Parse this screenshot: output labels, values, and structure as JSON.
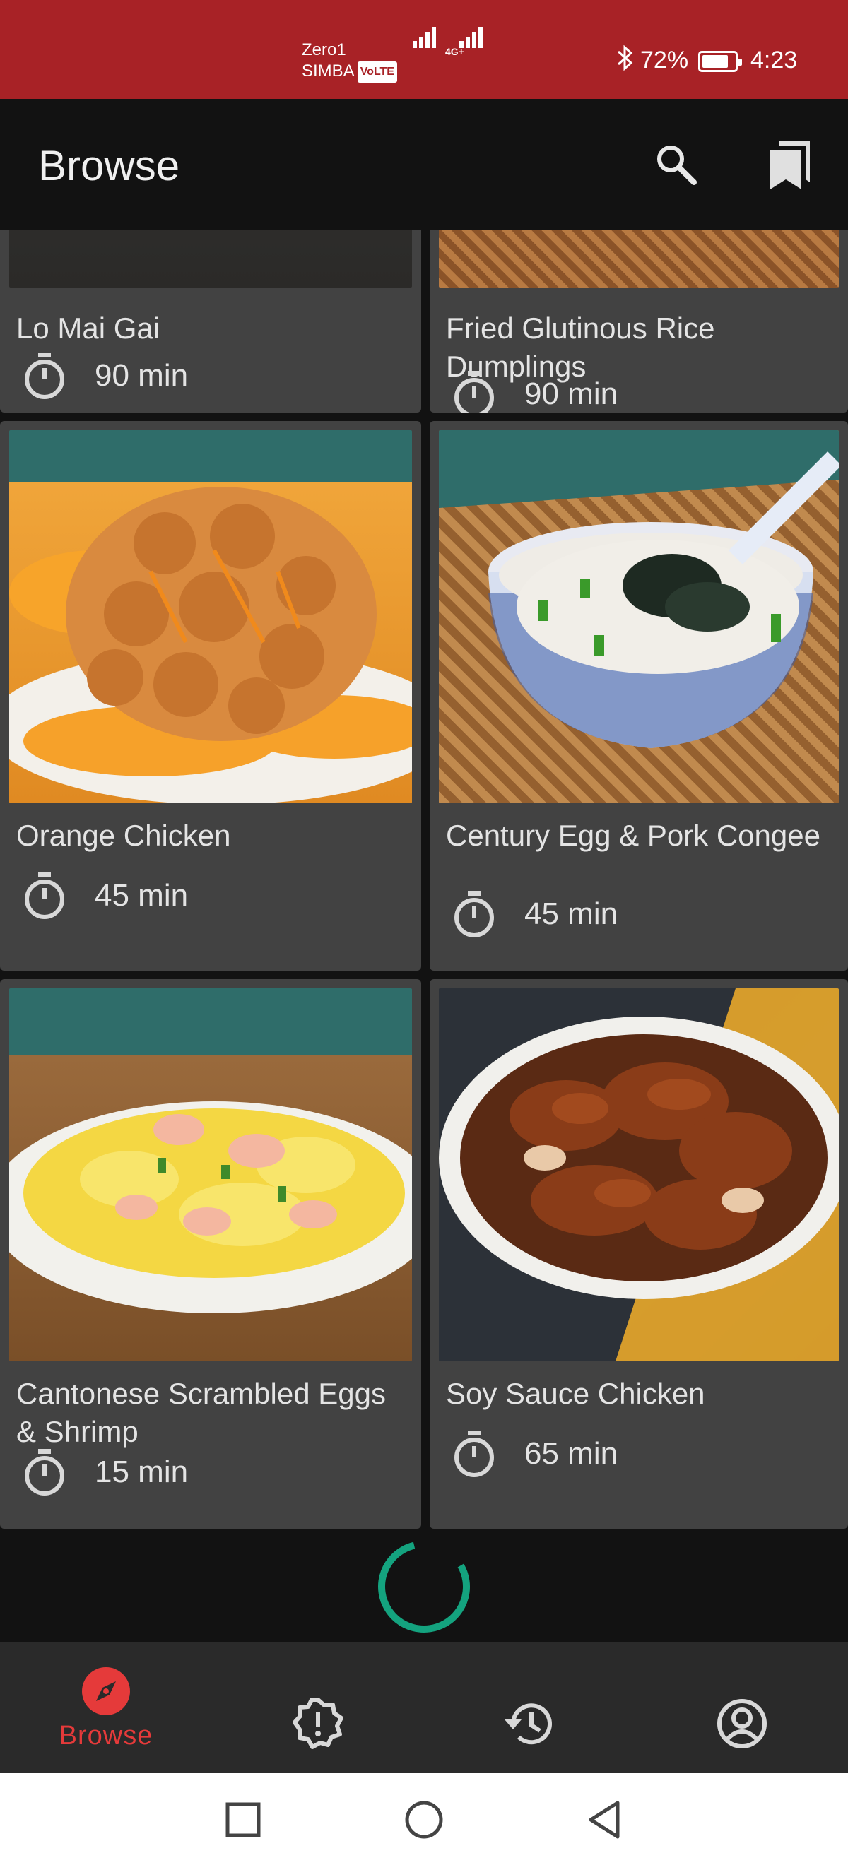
{
  "status_bar": {
    "carrier_line1": "Zero1",
    "carrier_line2": "SIMBA",
    "volte": "VoLTE",
    "network": "4G+",
    "battery_percent": "72%",
    "time": "4:23"
  },
  "app_bar": {
    "title": "Browse",
    "search_icon": "search-icon",
    "bookmarks_icon": "bookmarks-icon"
  },
  "recipes": [
    {
      "name": "Lo Mai Gai",
      "time": "90 min"
    },
    {
      "name": "Fried Glutinous Rice Dumplings",
      "time": "90 min"
    },
    {
      "name": "Orange Chicken",
      "time": "45 min"
    },
    {
      "name": "Century Egg & Pork Congee",
      "time": "45 min"
    },
    {
      "name": "Cantonese Scrambled Eggs & Shrimp",
      "time": "15 min"
    },
    {
      "name": "Soy Sauce Chicken",
      "time": "65 min"
    }
  ],
  "bottom_nav": {
    "items": [
      {
        "label": "Browse",
        "icon": "compass-icon",
        "active": true
      },
      {
        "label": "",
        "icon": "badge-alert-icon",
        "active": false
      },
      {
        "label": "",
        "icon": "history-icon",
        "active": false
      },
      {
        "label": "",
        "icon": "account-icon",
        "active": false
      }
    ]
  },
  "colors": {
    "status_bar": "#a82226",
    "accent": "#e53a3a",
    "loader": "#14a37f",
    "card": "#424242",
    "background": "#121212"
  }
}
